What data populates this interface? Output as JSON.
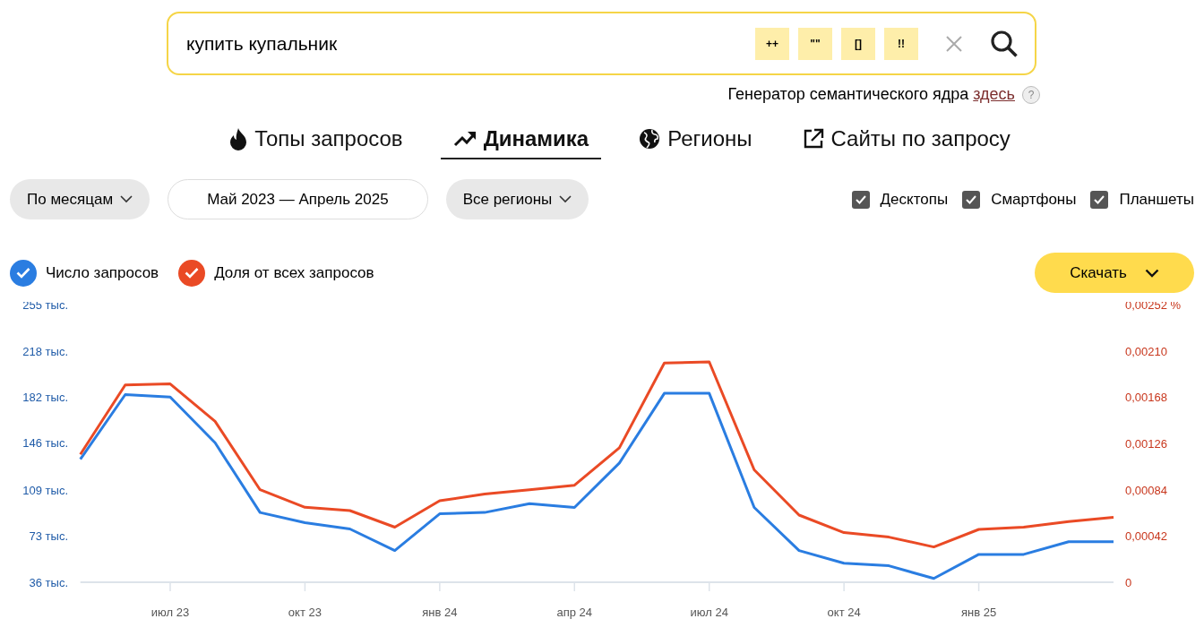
{
  "search": {
    "value": "купить купальник",
    "operators": [
      "++",
      "\"\"",
      "[]",
      "!!"
    ]
  },
  "generator": {
    "text": "Генератор семантического ядра",
    "link": "здесь",
    "help": "?"
  },
  "tabs": [
    {
      "label": "Топы запросов",
      "kind": "fire",
      "selected": false
    },
    {
      "label": "Динамика",
      "kind": "trend",
      "selected": true
    },
    {
      "label": "Регионы",
      "kind": "globe",
      "selected": false
    },
    {
      "label": "Сайты по запросу",
      "kind": "external",
      "selected": false
    }
  ],
  "filters": {
    "period": "По месяцам",
    "range": "Май 2023 — Апрель 2025",
    "region": "Все регионы"
  },
  "devices": [
    {
      "label": "Десктопы",
      "checked": true
    },
    {
      "label": "Смартфоны",
      "checked": true
    },
    {
      "label": "Планшеты",
      "checked": true
    }
  ],
  "legend": [
    {
      "checked": true
    },
    {
      "checked": true
    }
  ],
  "download": "Скачать",
  "chart": {
    "chart_data": {
      "type": "line",
      "categories": [
        null,
        null,
        "июл 23",
        null,
        null,
        "окт 23",
        null,
        null,
        "янв 24",
        null,
        null,
        "апр 24",
        null,
        null,
        "июл 24",
        null,
        null,
        "окт 24",
        null,
        null,
        "янв 25",
        null,
        null,
        null
      ],
      "series": [
        {
          "name": "Число запросов",
          "color": "#2a7de1",
          "values": [
            133,
            184,
            182,
            146,
            91,
            83,
            78,
            61,
            90,
            91,
            98,
            95,
            130,
            185,
            185,
            95,
            61,
            51,
            49,
            39,
            58,
            58,
            68,
            68
          ]
        }
      ],
      "ylim": [
        36,
        255
      ],
      "yticks": [
        {
          "value": 255,
          "label": "255 тыс."
        },
        {
          "value": 218,
          "label": "218 тыс."
        },
        {
          "value": 182,
          "label": "182 тыс."
        },
        {
          "value": 146,
          "label": "146 тыс."
        },
        {
          "value": 109,
          "label": "109 тыс."
        },
        {
          "value": 73,
          "label": "73 тыс."
        },
        {
          "value": 36,
          "label": "36 тыс."
        }
      ]
    }
  },
  "share_chart": {
    "chart_data": {
      "type": "line",
      "series": [
        {
          "name": "Доля от всех запросов",
          "color": "#ea4a25",
          "values": [
            0.00116,
            0.00179,
            0.0018,
            0.00146,
            0.00084,
            0.00068,
            0.00065,
            0.0005,
            0.00074,
            0.0008,
            0.00084,
            0.00088,
            0.00122,
            0.00199,
            0.002,
            0.00102,
            0.00061,
            0.00045,
            0.00041,
            0.00032,
            0.00048,
            0.0005,
            0.00055,
            0.00059
          ]
        }
      ],
      "ylim": [
        0,
        0.00252
      ],
      "yticks": [
        {
          "value": 0.00252,
          "label": "0,00252 %"
        },
        {
          "value": 0.0021,
          "label": "0,00210"
        },
        {
          "value": 0.00168,
          "label": "0,00168"
        },
        {
          "value": 0.00126,
          "label": "0,00126"
        },
        {
          "value": 0.00084,
          "label": "0,00084"
        },
        {
          "value": 0.00042,
          "label": "0,00042"
        },
        {
          "value": 0,
          "label": "0"
        }
      ]
    }
  }
}
